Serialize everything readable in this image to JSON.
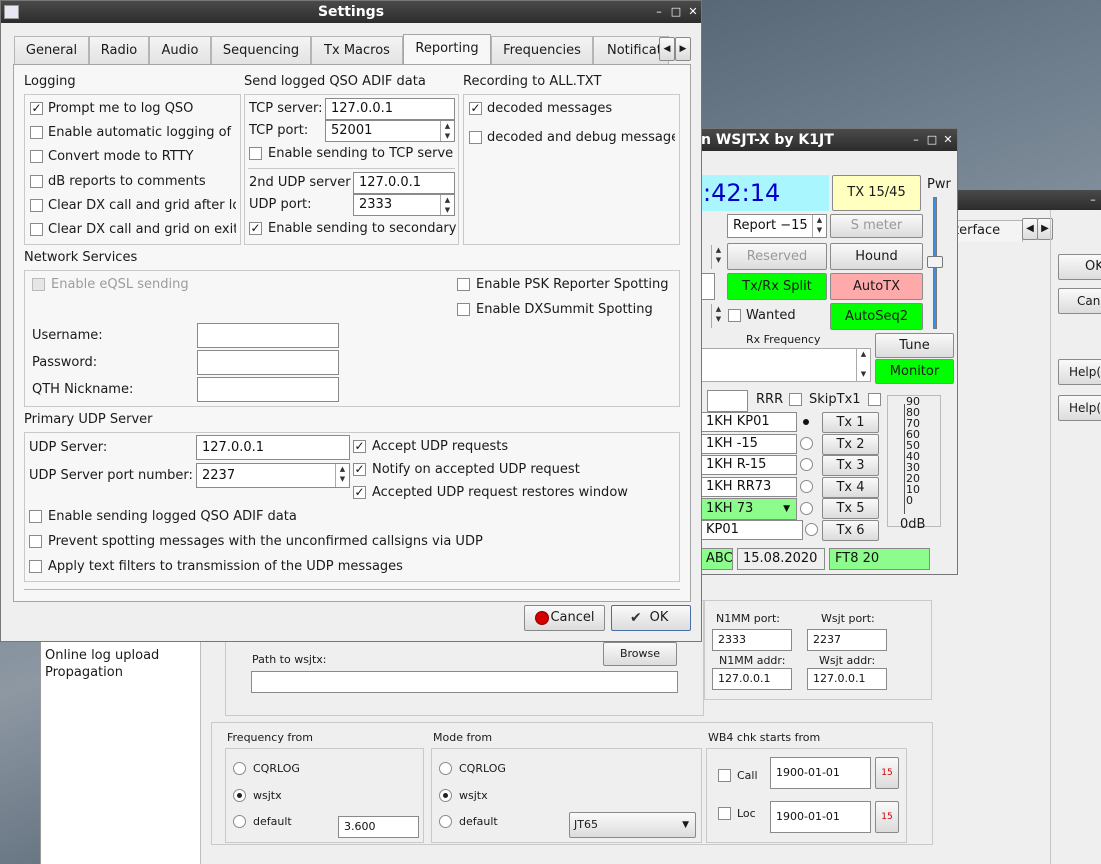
{
  "cqrlog": {
    "sidebar_items": [
      "Online log upload",
      "Propagation"
    ],
    "path_label": "Path to wsjtx:",
    "path_value": "",
    "browse_label": "Browse",
    "n1mm_port_label": "N1MM port:",
    "n1mm_port_value": "2333",
    "wsjt_port_label": "Wsjt port:",
    "wsjt_port_value": "2237",
    "n1mm_addr_label": "N1MM addr:",
    "n1mm_addr_value": "127.0.0.1",
    "wsjt_addr_label": "Wsjt addr:",
    "wsjt_addr_value": "127.0.0.1",
    "freq_from": {
      "title": "Frequency from",
      "options": [
        "CQRLOG",
        "wsjtx",
        "default"
      ],
      "selected": "wsjtx",
      "default_value": "3.600"
    },
    "mode_from": {
      "title": "Mode from",
      "options": [
        "CQRLOG",
        "wsjtx",
        "default"
      ],
      "selected": "wsjtx",
      "default_value": "JT65"
    },
    "wb4": {
      "title": "WB4 chk starts from",
      "call_label": "Call",
      "call_date": "1900-01-01",
      "loc_label": "Loc",
      "loc_date": "1900-01-01"
    },
    "tab_partial": "terface",
    "right_buttons": [
      "OK",
      "Canc",
      "Help(t",
      "Help(i"
    ]
  },
  "wsjtx": {
    "title": "n WSJT-X  by K1JT",
    "clock": ":42:14",
    "tx_counter": "TX 15/45",
    "pwr_label": "Pwr",
    "report": "Report −15",
    "s_meter": "S meter",
    "reserved": "Reserved",
    "hound": "Hound",
    "txrx_split": "Tx/Rx Split",
    "autotx": "AutoTX",
    "wanted": "Wanted",
    "autoseq": "AutoSeq2",
    "rx_freq_label": "Rx Frequency",
    "tune": "Tune",
    "monitor": "Monitor",
    "rrr": "RRR",
    "skiptx1": "SkipTx1",
    "tx_msgs": [
      "1KH KP01",
      "1KH -15",
      "1KH R-15",
      "1KH RR73",
      "1KH 73",
      "KP01"
    ],
    "tx_buttons": [
      "Tx 1",
      "Tx 2",
      "Tx 3",
      "Tx 4",
      "Tx 5",
      "Tx 6"
    ],
    "meter_ticks": [
      "90",
      "80",
      "70",
      "60",
      "50",
      "40",
      "30",
      "20",
      "10",
      "0"
    ],
    "db_label": "0dB",
    "status_call": "ABC",
    "status_date": "15.08.2020",
    "status_mode": "FT8  20",
    "colors": {
      "clock_bg": "#aaf6ff",
      "tx_counter_bg": "#ffffbf",
      "green": "#00ff00",
      "autotx_bg": "#ffaaaa",
      "status_green": "#8cfc8c"
    }
  },
  "settings": {
    "title": "Settings",
    "tabs": [
      "General",
      "Radio",
      "Audio",
      "Sequencing",
      "Tx Macros",
      "Reporting",
      "Frequencies",
      "Notificat"
    ],
    "active_tab": "Reporting",
    "logging": {
      "title": "Logging",
      "items": [
        {
          "label": "Prompt me to log QSO",
          "checked": true
        },
        {
          "label": "Enable automatic logging of",
          "checked": false
        },
        {
          "label": "Convert mode to RTTY",
          "checked": false
        },
        {
          "label": "dB reports to comments",
          "checked": false
        },
        {
          "label": "Clear DX call and grid after lo",
          "checked": false
        },
        {
          "label": "Clear DX call and grid on exit",
          "checked": false
        }
      ]
    },
    "adif": {
      "title": "Send logged QSO ADIF data",
      "tcp_server_label": "TCP server:",
      "tcp_server_value": "127.0.0.1",
      "tcp_port_label": "TCP port:",
      "tcp_port_value": "52001",
      "enable_tcp_label": "Enable sending to TCP serve",
      "enable_tcp_checked": false,
      "udp2_label": "2nd UDP server",
      "udp2_value": "127.0.0.1",
      "udp_port_label": "UDP port:",
      "udp_port_value": "2333",
      "enable_secondary_label": "Enable sending to secondary",
      "enable_secondary_checked": true
    },
    "recording": {
      "title": "Recording to ALL.TXT",
      "decoded_label": "decoded messages",
      "decoded_checked": true,
      "debug_label": "decoded and debug message",
      "debug_checked": false
    },
    "network": {
      "title": "Network Services",
      "eqsl_label": "Enable eQSL sending",
      "psk_label": "Enable PSK Reporter Spotting",
      "dxsummit_label": "Enable DXSummit Spotting",
      "username_label": "Username:",
      "username_value": "",
      "password_label": "Password:",
      "password_value": "",
      "qth_label": "QTH Nickname:",
      "qth_value": ""
    },
    "udp": {
      "title": "Primary UDP Server",
      "server_label": "UDP Server:",
      "server_value": "127.0.0.1",
      "port_label": "UDP Server port number:",
      "port_value": "2237",
      "accept_label": "Accept UDP requests",
      "notify_label": "Notify on accepted UDP request",
      "restore_label": "Accepted UDP request restores window",
      "send_adif_label": "Enable sending logged QSO ADIF data",
      "prevent_label": "Prevent spotting messages with the unconfirmed callsigns via UDP",
      "filters_label": "Apply text filters to transmission of the UDP messages"
    },
    "cancel_label": "Cancel",
    "ok_label": "OK"
  }
}
